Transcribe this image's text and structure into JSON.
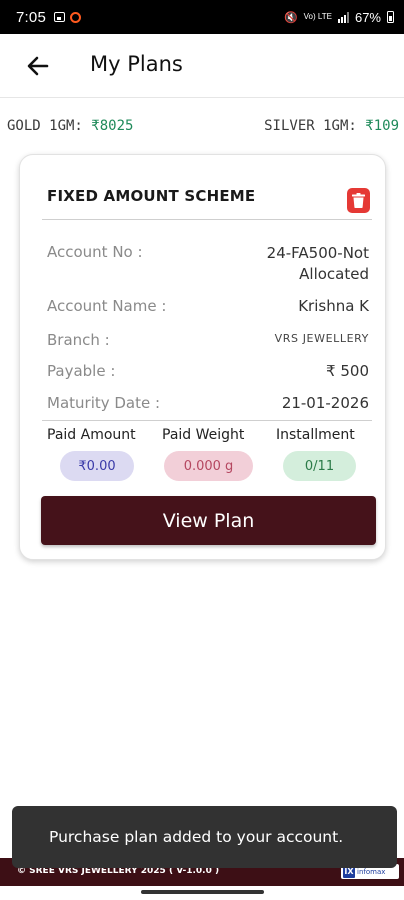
{
  "status_bar": {
    "time": "7:05",
    "battery": "67%",
    "network_label": "Vo) LTE",
    "network_gen": "4G+"
  },
  "app_bar": {
    "title": "My Plans",
    "back_icon": "arrow-left-icon"
  },
  "rates": {
    "gold_label": "GOLD 1GM:",
    "gold_value": "₹8025",
    "silver_label": "SILVER 1GM:",
    "silver_value": "₹109"
  },
  "plan_card": {
    "title": "FIXED AMOUNT SCHEME",
    "delete_icon": "trash-icon",
    "rows": [
      {
        "label": "Account No :",
        "value_line1": "24-FA500-Not",
        "value_line2": "Allocated"
      },
      {
        "label": "Account Name :",
        "value": "Krishna K"
      },
      {
        "label": "Branch :",
        "value": "VRS JEWELLERY"
      },
      {
        "label": "Payable :",
        "value": "₹ 500"
      },
      {
        "label": "Maturity Date :",
        "value": "21-01-2026"
      }
    ],
    "stats": [
      {
        "label": "Paid Amount",
        "value": "₹0.00"
      },
      {
        "label": "Paid Weight",
        "value": "0.000 g"
      },
      {
        "label": "Installment",
        "value": "0/11"
      }
    ],
    "view_button": "View Plan"
  },
  "toast": {
    "message": "Purchase plan added to your account."
  },
  "footer": {
    "copyright": "© SREE VRS JEWELLERY 2025 ( V-1.0.0 )",
    "logo_mark": "IX",
    "logo_text": "infomax"
  },
  "colors": {
    "accent_dark": "#45121a",
    "rate_green": "#1f8a5a",
    "delete_red": "#e53935"
  }
}
